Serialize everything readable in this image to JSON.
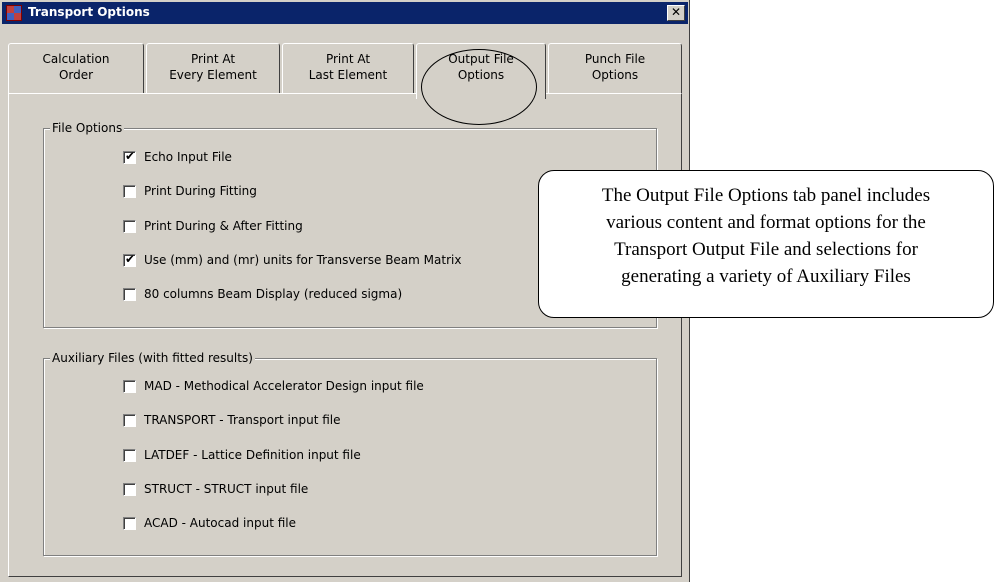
{
  "window": {
    "title": "Transport Options",
    "close_glyph": "✕"
  },
  "tabs": [
    {
      "line1": "Calculation",
      "line2": "Order"
    },
    {
      "line1": "Print At",
      "line2": "Every Element"
    },
    {
      "line1": "Print At",
      "line2": "Last Element"
    },
    {
      "line1": "Output File",
      "line2": "Options",
      "selected": true
    },
    {
      "line1": "Punch File",
      "line2": "Options"
    }
  ],
  "file_options": {
    "label": "File Options",
    "items": [
      {
        "label": "Echo Input File",
        "checked": true
      },
      {
        "label": "Print During Fitting",
        "checked": false
      },
      {
        "label": "Print During & After Fitting",
        "checked": false
      },
      {
        "label": "Use (mm) and (mr) units for Transverse Beam Matrix",
        "checked": true
      },
      {
        "label": "80 columns Beam Display (reduced sigma)",
        "checked": false
      }
    ]
  },
  "auxiliary_files": {
    "label": "Auxiliary Files (with fitted results)",
    "items": [
      {
        "label": "MAD - Methodical Accelerator Design input file",
        "checked": false
      },
      {
        "label": "TRANSPORT - Transport input file",
        "checked": false
      },
      {
        "label": "LATDEF - Lattice Definition input file",
        "checked": false
      },
      {
        "label": "STRUCT - STRUCT input file",
        "checked": false
      },
      {
        "label": "ACAD - Autocad input file",
        "checked": false
      }
    ]
  },
  "callout": {
    "lines": [
      "The Output File Options tab panel includes",
      "various content and format options for the",
      "Transport Output File and selections for",
      "generating a variety of Auxiliary Files"
    ]
  },
  "check_glyph": "✔"
}
